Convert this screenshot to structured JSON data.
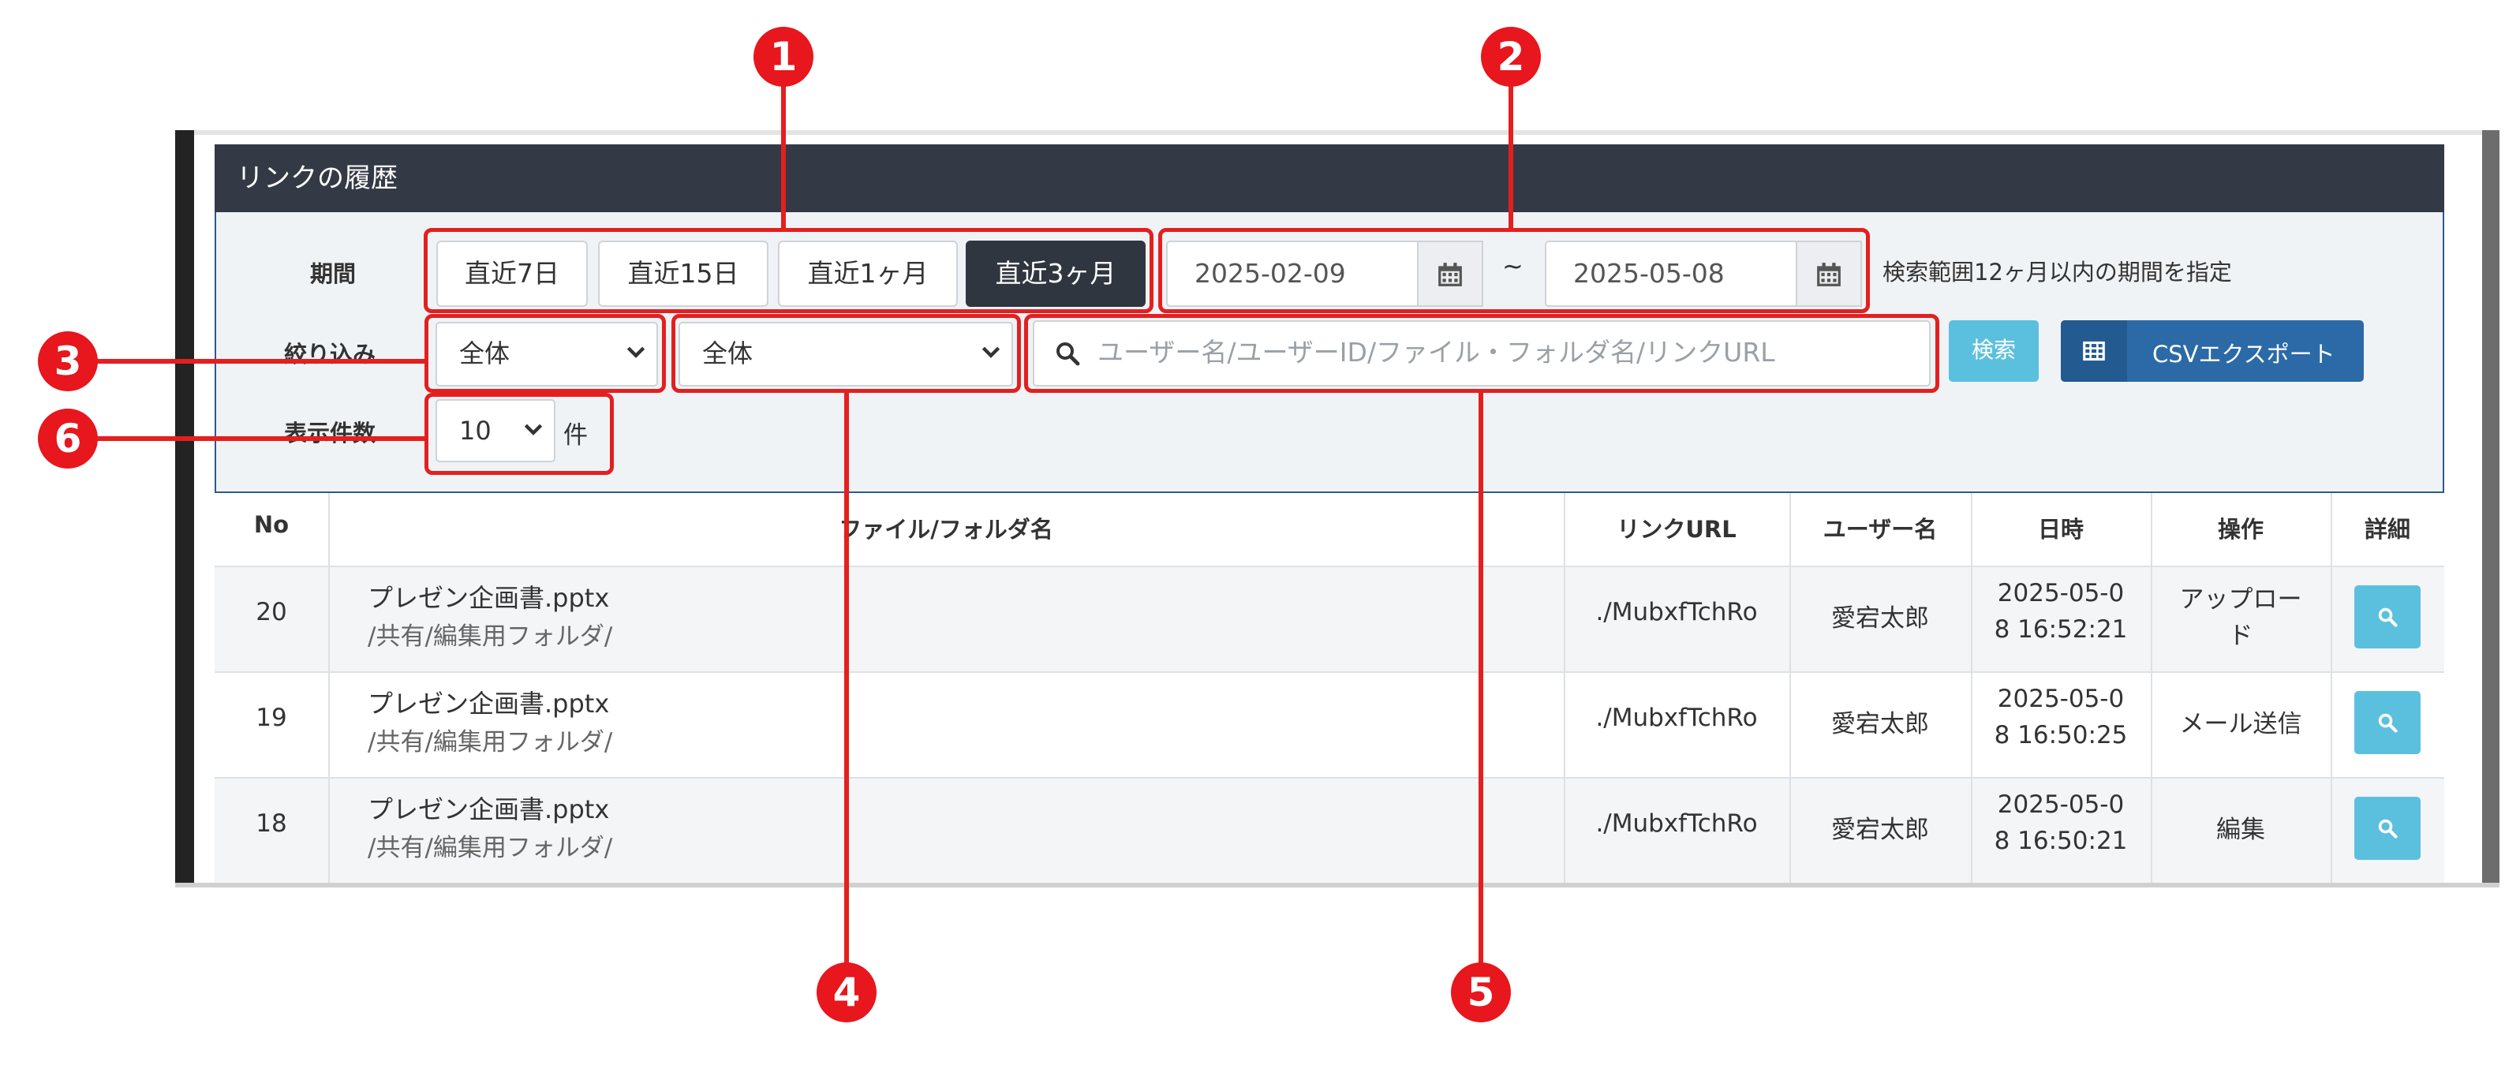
{
  "panel": {
    "title": "リンクの履歴"
  },
  "filters": {
    "period_label": "期間",
    "period_buttons": [
      "直近7日",
      "直近15日",
      "直近1ヶ月",
      "直近3ヶ月"
    ],
    "active_period": "直近3ヶ月",
    "date_from": "2025-02-09",
    "tilde": "~",
    "date_to": "2025-05-08",
    "range_note": "検索範囲12ヶ月以内の期間を指定",
    "narrow_label": "絞り込み",
    "select1": "全体",
    "select2": "全体",
    "search_placeholder": "ユーザー名/ユーザーID/ファイル・フォルダ名/リンクURL",
    "search_button": "検索",
    "csv_button": "CSVエクスポート",
    "count_label": "表示件数",
    "count_value": "10",
    "count_unit": "件"
  },
  "table": {
    "headers": [
      "No",
      "ファイル/フォルダ名",
      "リンクURL",
      "ユーザー名",
      "日時",
      "操作",
      "詳細"
    ],
    "rows": [
      {
        "no": "20",
        "file": "プレゼン企画書.pptx",
        "path": "/共有/編集用フォルダ/",
        "url": "./MubxfTchRo",
        "user": "愛宕太郎",
        "dt1": "2025-05-0",
        "dt2": "8 16:52:21",
        "op1": "アップロー",
        "op2": "ド"
      },
      {
        "no": "19",
        "file": "プレゼン企画書.pptx",
        "path": "/共有/編集用フォルダ/",
        "url": "./MubxfTchRo",
        "user": "愛宕太郎",
        "dt1": "2025-05-0",
        "dt2": "8 16:50:25",
        "op1": "メール送信",
        "op2": ""
      },
      {
        "no": "18",
        "file": "プレゼン企画書.pptx",
        "path": "/共有/編集用フォルダ/",
        "url": "./MubxfTchRo",
        "user": "愛宕太郎",
        "dt1": "2025-05-0",
        "dt2": "8 16:50:21",
        "op1": "編集",
        "op2": ""
      }
    ]
  },
  "callouts": [
    "1",
    "2",
    "3",
    "4",
    "5",
    "6"
  ],
  "colors": {
    "annotation": "#e41f1f",
    "header": "#343a45",
    "search_button": "#5bc0de",
    "csv_button": "#2b6aa6"
  }
}
